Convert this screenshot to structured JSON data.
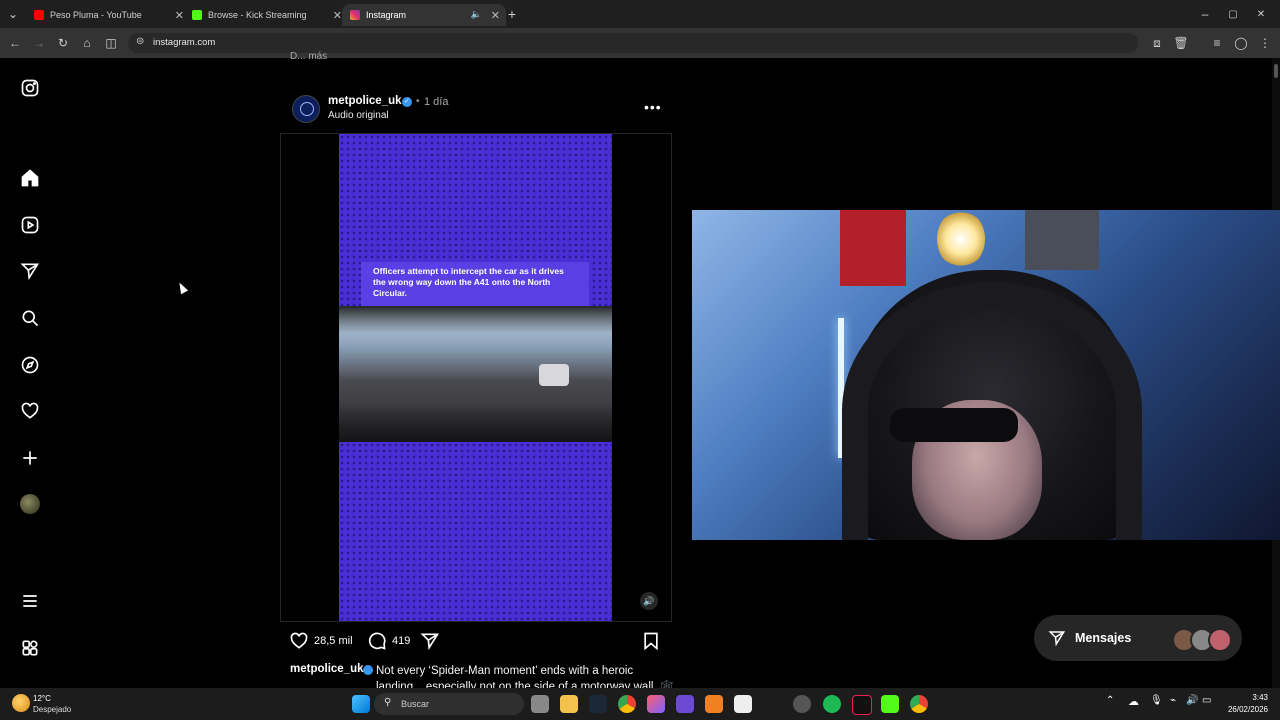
{
  "browser": {
    "tabs": [
      {
        "title": "Peso Pluma - YouTube",
        "color": "#ff0000"
      },
      {
        "title": "Browse - Kick Streaming",
        "color": "#53fc18"
      },
      {
        "title": "Instagram",
        "color": "#e1306c"
      }
    ],
    "url": "instagram.com",
    "new_tab": "+",
    "window_min": "–",
    "window_max": "▢",
    "window_close": "✕"
  },
  "previous_post": {
    "tail": "D... más"
  },
  "post": {
    "username": "metpolice_uk",
    "verified_mark": "✓",
    "separator": "•",
    "time": "1 día",
    "audio": "Audio original",
    "more": "•••",
    "video_caption": "Officers attempt to intercept the car as it drives the wrong way down the A41 onto the North Circular.",
    "likes": "28,5 mil",
    "comments": "419",
    "caption_user": "metpolice_uk",
    "caption_text": "Not every ‘Spider-Man moment’ ends with a heroic landing... especially not on the side of a motorway wall. 🕸️"
  },
  "messages": {
    "label": "Mensajes"
  },
  "taskbar": {
    "temp": "12°C",
    "weather": "Despejado",
    "search": "Buscar",
    "time": "3:43",
    "date": "26/02/2026"
  },
  "colors": {
    "accent": "#3797f0",
    "video_purple": "#4b2fd6"
  }
}
